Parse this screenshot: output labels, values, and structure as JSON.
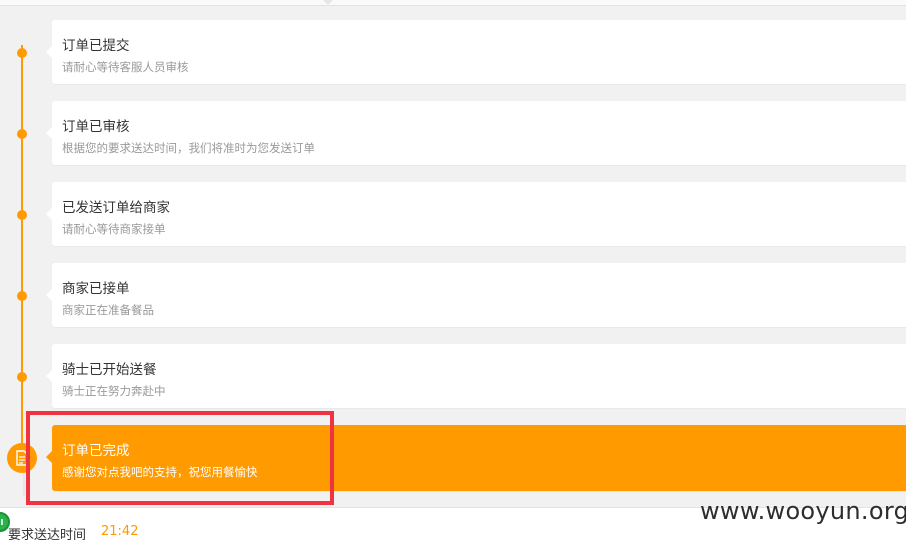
{
  "timeline": [
    {
      "title": "订单已提交",
      "desc": "请耐心等待客服人员审核"
    },
    {
      "title": "订单已审核",
      "desc": "根据您的要求送达时间，我们将准时为您发送订单"
    },
    {
      "title": "已发送订单给商家",
      "desc": "请耐心等待商家接单"
    },
    {
      "title": "商家已接单",
      "desc": "商家正在准备餐品"
    },
    {
      "title": "骑士已开始送餐",
      "desc": "骑士正在努力奔赴中"
    },
    {
      "title": "订单已完成",
      "desc": "感谢您对点我吧的支持，祝您用餐愉快"
    }
  ],
  "footer": {
    "delivery_label": "要求送达时间",
    "delivery_time": "21:42"
  },
  "watermark": "www.wooyun.org",
  "colors": {
    "accent": "#ff9a00",
    "highlight": "#ef3340"
  },
  "icons": {
    "status": "document-icon",
    "footer": "clock-icon"
  }
}
